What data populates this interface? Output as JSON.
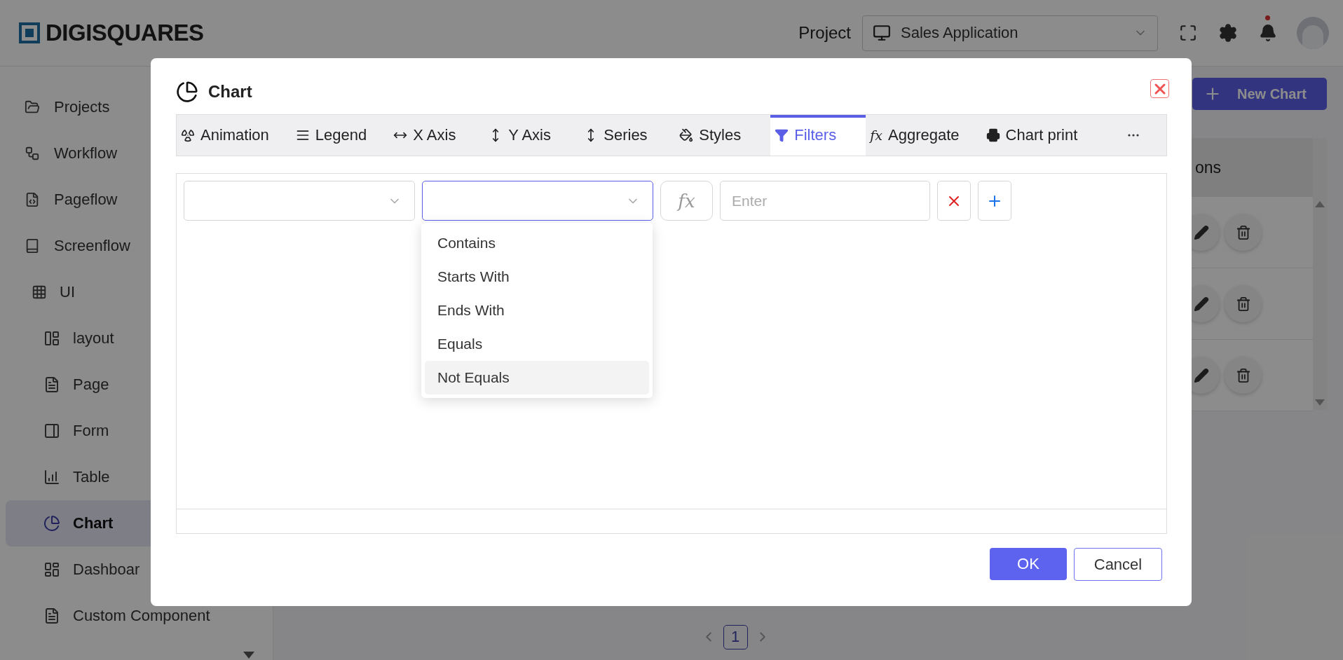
{
  "header": {
    "logo": "DIGISQUARES",
    "project_label": "Project",
    "project_select": "Sales Application"
  },
  "sidebar": {
    "items": [
      {
        "label": "Projects",
        "selected": false
      },
      {
        "label": "Workflow",
        "selected": false
      },
      {
        "label": "Pageflow",
        "selected": false
      },
      {
        "label": "Screenflow",
        "selected": false
      },
      {
        "label": "UI",
        "selected": false,
        "children": [
          {
            "label": "layout",
            "selected": false
          },
          {
            "label": "Page",
            "selected": false
          },
          {
            "label": "Form",
            "selected": false
          },
          {
            "label": "Table",
            "selected": false
          },
          {
            "label": "Chart",
            "selected": true
          },
          {
            "label": "Dashboar",
            "selected": false
          },
          {
            "label": "Custom Component",
            "selected": false
          }
        ]
      }
    ]
  },
  "main": {
    "new_chart_button": "New Chart",
    "table_header": "ons",
    "pagination": [
      {
        "label": "1",
        "selected": true
      }
    ]
  },
  "dialog": {
    "title": "Chart",
    "tabs": [
      {
        "label": "Animation",
        "selected": false
      },
      {
        "label": "Legend",
        "selected": false
      },
      {
        "label": "X Axis",
        "selected": false
      },
      {
        "label": "Y Axis",
        "selected": false
      },
      {
        "label": "Series",
        "selected": false
      },
      {
        "label": "Styles",
        "selected": false
      },
      {
        "label": "Filters",
        "selected": true
      },
      {
        "label": "Aggregate",
        "selected": false,
        "prefix": "fx"
      },
      {
        "label": "Chart print",
        "selected": false
      }
    ],
    "filter": {
      "operator_open": true,
      "fx_button": "fx",
      "value_placeholder": "Enter",
      "options": [
        {
          "label": "Contains",
          "selected": false
        },
        {
          "label": "Starts With",
          "selected": false
        },
        {
          "label": "Ends With",
          "selected": false
        },
        {
          "label": "Equals",
          "selected": false
        },
        {
          "label": "Not Equals",
          "selected": true
        }
      ]
    },
    "buttons": {
      "ok": "OK",
      "cancel": "Cancel"
    }
  }
}
